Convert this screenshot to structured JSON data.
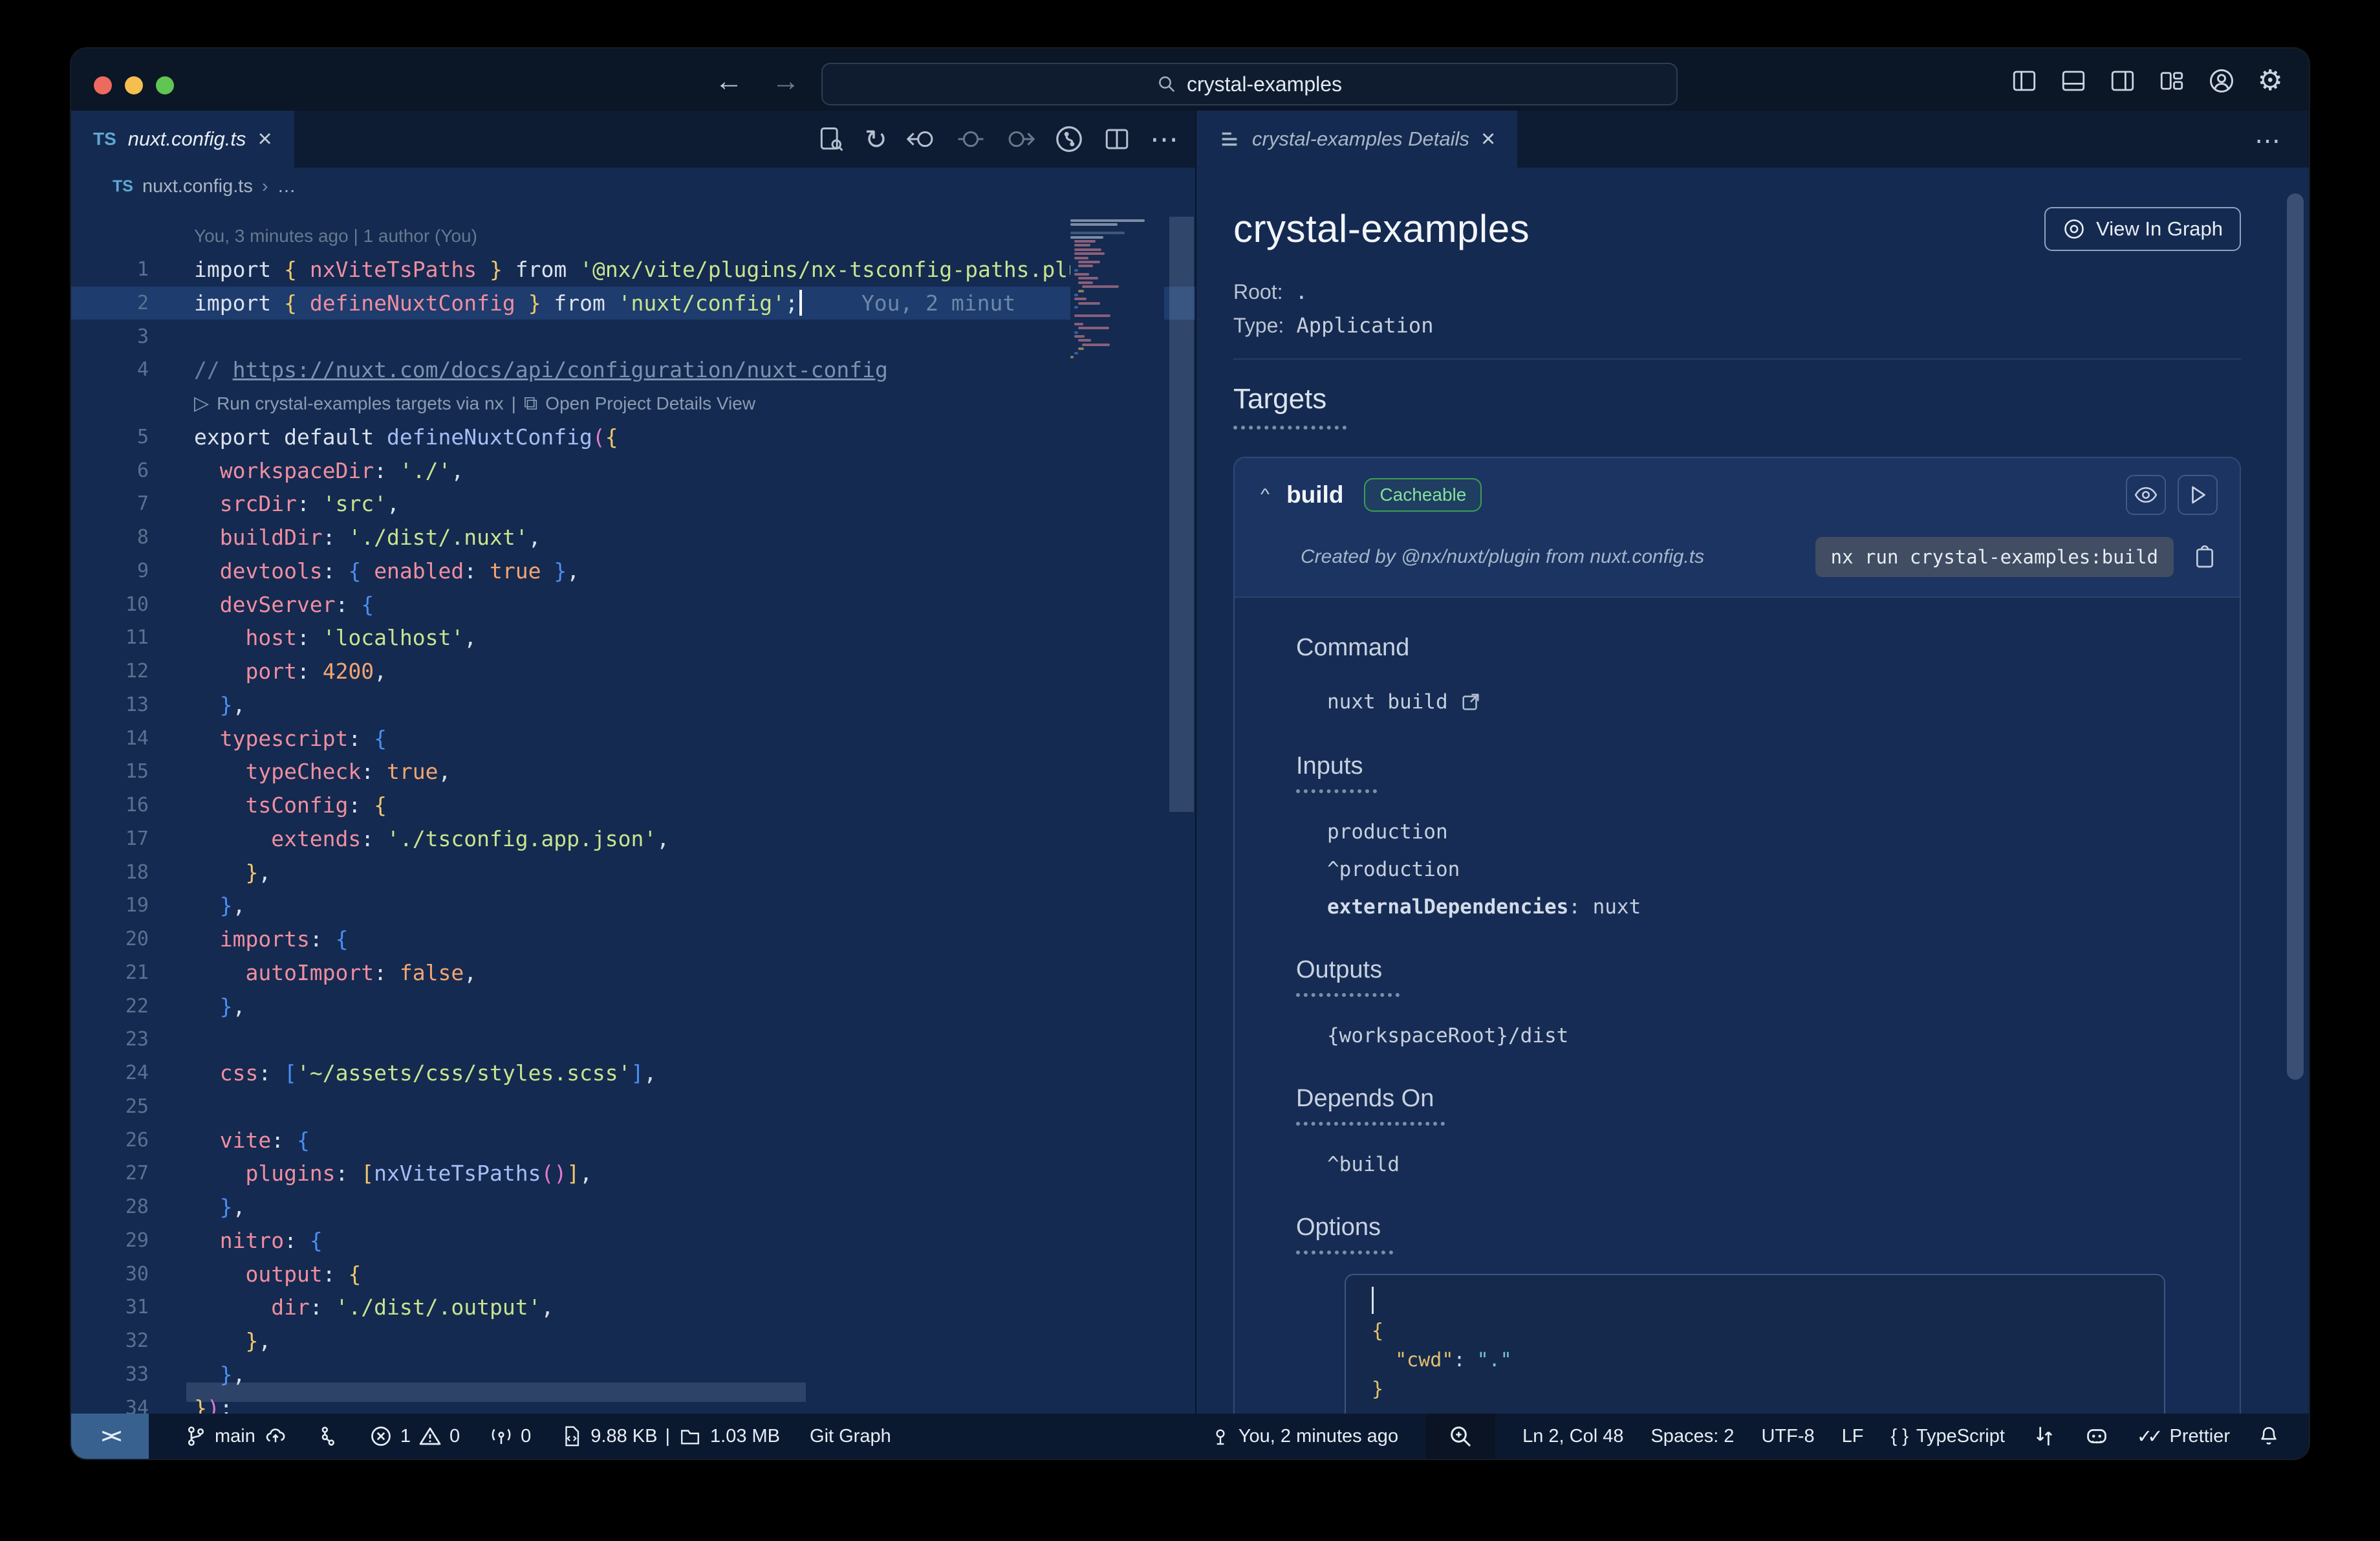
{
  "titlebar": {
    "search_value": "crystal-examples"
  },
  "editor": {
    "tab": {
      "lang": "TS",
      "label": "nuxt.config.ts",
      "close": "×"
    },
    "breadcrumb": {
      "lang": "TS",
      "file": "nuxt.config.ts",
      "sep": "›",
      "more": "…"
    },
    "actions_more": "⋯",
    "rows": [
      {
        "type": "blame",
        "text": "You, 3 minutes ago | 1 author (You)"
      },
      {
        "type": "code",
        "n": "1",
        "indent": 0,
        "tokens": [
          [
            "pl",
            "import "
          ],
          [
            "g",
            "{ "
          ],
          [
            "pr",
            "nxViteTsPaths"
          ],
          [
            "g",
            " }"
          ],
          [
            "pl",
            " from "
          ],
          [
            "st",
            "'@nx/vite/plugins/nx-tsconfig-paths.plugin'"
          ],
          [
            "pl",
            ";"
          ]
        ]
      },
      {
        "type": "code",
        "n": "2",
        "cur": true,
        "cursor": true,
        "ghost": "You, 2 minut",
        "indent": 0,
        "tokens": [
          [
            "pl",
            "import "
          ],
          [
            "g",
            "{ "
          ],
          [
            "pr",
            "defineNuxtConfig"
          ],
          [
            "g",
            " }"
          ],
          [
            "pl",
            " from "
          ],
          [
            "st",
            "'nuxt/config'"
          ],
          [
            "pl",
            ";"
          ]
        ]
      },
      {
        "type": "code",
        "n": "3",
        "indent": 0,
        "tokens": []
      },
      {
        "type": "code",
        "n": "4",
        "indent": 0,
        "tokens": [
          [
            "cm",
            "// "
          ],
          [
            "lk",
            "https://nuxt.com/docs/api/configuration/nuxt-config"
          ]
        ]
      },
      {
        "type": "lens",
        "text": "Run crystal-examples targets via nx",
        "sep": "|",
        "text2": "Open Project Details View"
      },
      {
        "type": "code",
        "n": "5",
        "indent": 0,
        "tokens": [
          [
            "pl",
            "export default "
          ],
          [
            "fn",
            "defineNuxtConfig"
          ],
          [
            "pk",
            "("
          ],
          [
            "g",
            "{"
          ]
        ]
      },
      {
        "type": "code",
        "n": "6",
        "indent": 1,
        "tokens": [
          [
            "pr",
            "workspaceDir"
          ],
          [
            "pl",
            ": "
          ],
          [
            "st",
            "'./'"
          ],
          [
            "pl",
            ","
          ]
        ]
      },
      {
        "type": "code",
        "n": "7",
        "indent": 1,
        "tokens": [
          [
            "pr",
            "srcDir"
          ],
          [
            "pl",
            ": "
          ],
          [
            "st",
            "'src'"
          ],
          [
            "pl",
            ","
          ]
        ]
      },
      {
        "type": "code",
        "n": "8",
        "indent": 1,
        "tokens": [
          [
            "pr",
            "buildDir"
          ],
          [
            "pl",
            ": "
          ],
          [
            "st",
            "'./dist/.nuxt'"
          ],
          [
            "pl",
            ","
          ]
        ]
      },
      {
        "type": "code",
        "n": "9",
        "indent": 1,
        "tokens": [
          [
            "pr",
            "devtools"
          ],
          [
            "pl",
            ": "
          ],
          [
            "bl",
            "{ "
          ],
          [
            "pr",
            "enabled"
          ],
          [
            "pl",
            ": "
          ],
          [
            "or",
            "true"
          ],
          [
            "bl",
            " }"
          ],
          [
            "pl",
            ","
          ]
        ]
      },
      {
        "type": "code",
        "n": "10",
        "indent": 1,
        "tokens": [
          [
            "pr",
            "devServer"
          ],
          [
            "pl",
            ": "
          ],
          [
            "bl",
            "{"
          ]
        ]
      },
      {
        "type": "code",
        "n": "11",
        "indent": 2,
        "tokens": [
          [
            "pr",
            "host"
          ],
          [
            "pl",
            ": "
          ],
          [
            "st",
            "'localhost'"
          ],
          [
            "pl",
            ","
          ]
        ]
      },
      {
        "type": "code",
        "n": "12",
        "indent": 2,
        "tokens": [
          [
            "pr",
            "port"
          ],
          [
            "pl",
            ": "
          ],
          [
            "or",
            "4200"
          ],
          [
            "pl",
            ","
          ]
        ]
      },
      {
        "type": "code",
        "n": "13",
        "indent": 1,
        "tokens": [
          [
            "bl",
            "}"
          ],
          [
            "pl",
            ","
          ]
        ]
      },
      {
        "type": "code",
        "n": "14",
        "indent": 1,
        "tokens": [
          [
            "pr",
            "typescript"
          ],
          [
            "pl",
            ": "
          ],
          [
            "bl",
            "{"
          ]
        ]
      },
      {
        "type": "code",
        "n": "15",
        "indent": 2,
        "tokens": [
          [
            "pr",
            "typeCheck"
          ],
          [
            "pl",
            ": "
          ],
          [
            "or",
            "true"
          ],
          [
            "pl",
            ","
          ]
        ]
      },
      {
        "type": "code",
        "n": "16",
        "indent": 2,
        "tokens": [
          [
            "pr",
            "tsConfig"
          ],
          [
            "pl",
            ": "
          ],
          [
            "g",
            "{"
          ]
        ]
      },
      {
        "type": "code",
        "n": "17",
        "indent": 3,
        "tokens": [
          [
            "pr",
            "extends"
          ],
          [
            "pl",
            ": "
          ],
          [
            "st",
            "'./tsconfig.app.json'"
          ],
          [
            "pl",
            ","
          ]
        ]
      },
      {
        "type": "code",
        "n": "18",
        "indent": 2,
        "tokens": [
          [
            "g",
            "}"
          ],
          [
            "pl",
            ","
          ]
        ]
      },
      {
        "type": "code",
        "n": "19",
        "indent": 1,
        "tokens": [
          [
            "bl",
            "}"
          ],
          [
            "pl",
            ","
          ]
        ]
      },
      {
        "type": "code",
        "n": "20",
        "indent": 1,
        "tokens": [
          [
            "pr",
            "imports"
          ],
          [
            "pl",
            ": "
          ],
          [
            "bl",
            "{"
          ]
        ]
      },
      {
        "type": "code",
        "n": "21",
        "indent": 2,
        "tokens": [
          [
            "pr",
            "autoImport"
          ],
          [
            "pl",
            ": "
          ],
          [
            "or",
            "false"
          ],
          [
            "pl",
            ","
          ]
        ]
      },
      {
        "type": "code",
        "n": "22",
        "indent": 1,
        "tokens": [
          [
            "bl",
            "}"
          ],
          [
            "pl",
            ","
          ]
        ]
      },
      {
        "type": "code",
        "n": "23",
        "indent": 0,
        "tokens": []
      },
      {
        "type": "code",
        "n": "24",
        "indent": 1,
        "tokens": [
          [
            "pr",
            "css"
          ],
          [
            "pl",
            ": "
          ],
          [
            "bl",
            "["
          ],
          [
            "st",
            "'~/assets/css/styles.scss'"
          ],
          [
            "bl",
            "]"
          ],
          [
            "pl",
            ","
          ]
        ]
      },
      {
        "type": "code",
        "n": "25",
        "indent": 0,
        "tokens": []
      },
      {
        "type": "code",
        "n": "26",
        "indent": 1,
        "tokens": [
          [
            "pr",
            "vite"
          ],
          [
            "pl",
            ": "
          ],
          [
            "bl",
            "{"
          ]
        ]
      },
      {
        "type": "code",
        "n": "27",
        "indent": 2,
        "tokens": [
          [
            "pr",
            "plugins"
          ],
          [
            "pl",
            ": "
          ],
          [
            "g",
            "["
          ],
          [
            "fn",
            "nxViteTsPaths"
          ],
          [
            "pk",
            "()"
          ],
          [
            "g",
            "]"
          ],
          [
            "pl",
            ","
          ]
        ]
      },
      {
        "type": "code",
        "n": "28",
        "indent": 1,
        "tokens": [
          [
            "bl",
            "}"
          ],
          [
            "pl",
            ","
          ]
        ]
      },
      {
        "type": "code",
        "n": "29",
        "indent": 1,
        "tokens": [
          [
            "pr",
            "nitro"
          ],
          [
            "pl",
            ": "
          ],
          [
            "bl",
            "{"
          ]
        ]
      },
      {
        "type": "code",
        "n": "30",
        "indent": 2,
        "tokens": [
          [
            "pr",
            "output"
          ],
          [
            "pl",
            ": "
          ],
          [
            "g",
            "{"
          ]
        ]
      },
      {
        "type": "code",
        "n": "31",
        "indent": 3,
        "tokens": [
          [
            "pr",
            "dir"
          ],
          [
            "pl",
            ": "
          ],
          [
            "st",
            "'./dist/.output'"
          ],
          [
            "pl",
            ","
          ]
        ]
      },
      {
        "type": "code",
        "n": "32",
        "indent": 2,
        "tokens": [
          [
            "g",
            "}"
          ],
          [
            "pl",
            ","
          ]
        ]
      },
      {
        "type": "code",
        "n": "33",
        "indent": 1,
        "tokens": [
          [
            "bl",
            "}"
          ],
          [
            "pl",
            ","
          ]
        ]
      },
      {
        "type": "code",
        "n": "34",
        "indent": 0,
        "tokens": [
          [
            "g",
            "}"
          ],
          [
            "pk",
            ")"
          ],
          [
            "pl",
            ";"
          ]
        ]
      }
    ]
  },
  "panel": {
    "tab": {
      "label": "crystal-examples Details",
      "close": "×"
    },
    "tabbar_more": "⋯",
    "title": "crystal-examples",
    "view_in_graph": "View In Graph",
    "root_label": "Root:",
    "root_value": ".",
    "type_label": "Type:",
    "type_value": "Application",
    "targets_heading": "Targets",
    "build": {
      "name": "build",
      "badge": "Cacheable",
      "created_by": "Created by @nx/nuxt/plugin from nuxt.config.ts",
      "command_chip": "nx run crystal-examples:build",
      "command_heading": "Command",
      "command_value": "nuxt build",
      "inputs_heading": "Inputs",
      "inputs": [
        "production",
        "^production"
      ],
      "inputs_kv_key": "externalDependencies",
      "inputs_kv_sep": ": ",
      "inputs_kv_value": "nuxt",
      "outputs_heading": "Outputs",
      "outputs": [
        "{workspaceRoot}/dist"
      ],
      "depends_heading": "Depends On",
      "depends": [
        "^build"
      ],
      "options_heading": "Options",
      "options_open": "{",
      "options_key": "\"cwd\"",
      "options_colon": ": ",
      "options_value": "\".\"",
      "options_close": "}"
    }
  },
  "statusbar": {
    "remote": "><",
    "branch": "main",
    "errors": "1",
    "warnings": "0",
    "ports": "0",
    "size": "9.88 KB",
    "sep": "|",
    "mem": "1.03 MB",
    "git_graph": "Git Graph",
    "blame": "You, 2 minutes ago",
    "position": "Ln 2, Col 48",
    "indentation": "Spaces: 2",
    "encoding": "UTF-8",
    "eol": "LF",
    "lang_braces": "{ }",
    "language": "TypeScript",
    "prettier_check": "✓✓",
    "prettier": "Prettier"
  }
}
